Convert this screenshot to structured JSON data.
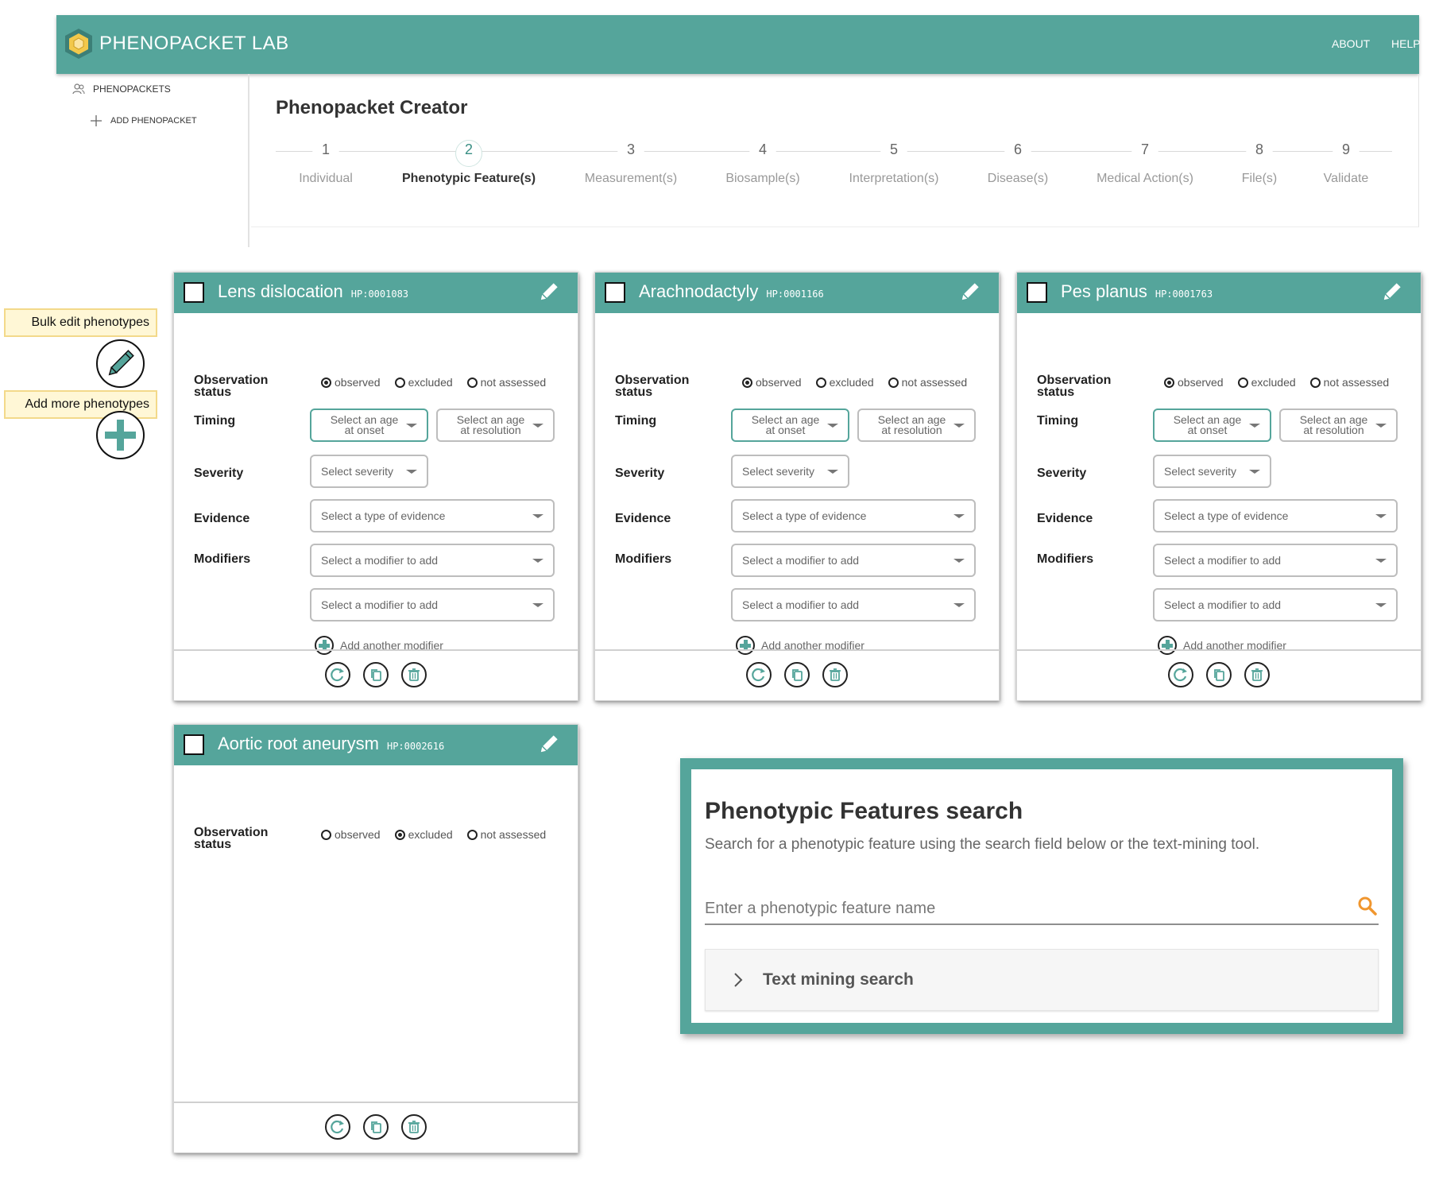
{
  "app": {
    "title": "PHENOPACKET LAB",
    "nav": [
      "ABOUT",
      "HELP"
    ]
  },
  "sidebar": {
    "items": [
      {
        "label": "PHENOPACKETS",
        "icon": "people-icon"
      },
      {
        "label": "ADD PHENOPACKET",
        "icon": "plus-icon"
      }
    ]
  },
  "creator": {
    "title": "Phenopacket Creator",
    "active_step": 2,
    "steps": [
      {
        "num": "1",
        "label": "Individual"
      },
      {
        "num": "2",
        "label": "Phenotypic Feature(s)"
      },
      {
        "num": "3",
        "label": "Measurement(s)"
      },
      {
        "num": "4",
        "label": "Biosample(s)"
      },
      {
        "num": "5",
        "label": "Interpretation(s)"
      },
      {
        "num": "6",
        "label": "Disease(s)"
      },
      {
        "num": "7",
        "label": "Medical Action(s)"
      },
      {
        "num": "8",
        "label": "File(s)"
      },
      {
        "num": "9",
        "label": "Validate"
      }
    ]
  },
  "callouts": {
    "bulk_edit": "Bulk edit phenotypes",
    "add_more": "Add more phenotypes"
  },
  "labels": {
    "observation_status": "Observation status",
    "timing": "Timing",
    "severity": "Severity",
    "evidence": "Evidence",
    "modifiers": "Modifiers",
    "observed": "observed",
    "excluded": "excluded",
    "not_assessed": "not assessed",
    "age_onset_1": "Select an age",
    "age_onset_2": "at onset",
    "age_resolution_1": "Select an age",
    "age_resolution_2": "at resolution",
    "severity_placeholder": "Select severity",
    "evidence_placeholder": "Select a type of evidence",
    "modifier_placeholder": "Select a modifier to add",
    "add_modifier": "Add another modifier"
  },
  "cards": [
    {
      "name": "Lens dislocation",
      "hpo": "HP:0001083",
      "status": "observed"
    },
    {
      "name": "Arachnodactyly",
      "hpo": "HP:0001166",
      "status": "observed"
    },
    {
      "name": "Pes planus",
      "hpo": "HP:0001763",
      "status": "observed"
    },
    {
      "name": "Aortic root aneurysm",
      "hpo": "HP:0002616",
      "status": "excluded"
    }
  ],
  "search": {
    "title": "Phenotypic Features search",
    "subtitle": "Search for a phenotypic feature using the search field below or the text-mining tool.",
    "placeholder": "Enter a phenotypic feature name",
    "text_mining": "Text mining search"
  },
  "colors": {
    "primary": "#55a59b",
    "search_icon": "#f0962e",
    "logo": "#f2c84b"
  }
}
